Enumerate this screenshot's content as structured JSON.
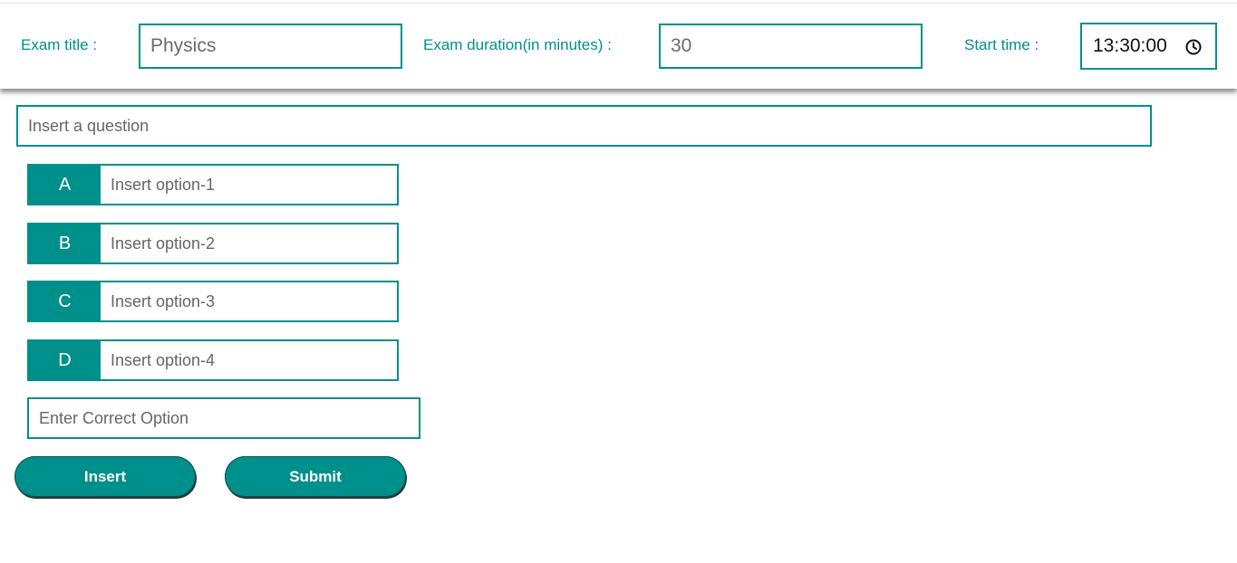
{
  "header": {
    "exam_title_label": "Exam title :",
    "exam_title_value": "Physics",
    "duration_label": "Exam duration(in minutes) :",
    "duration_value": "30",
    "start_time_label": "Start time :",
    "start_time_value": "13:30:00",
    "start_time_icon": "clock-icon"
  },
  "question": {
    "placeholder": "Insert a question"
  },
  "options": [
    {
      "letter": "A",
      "placeholder": "Insert option-1"
    },
    {
      "letter": "B",
      "placeholder": "Insert option-2"
    },
    {
      "letter": "C",
      "placeholder": "Insert option-3"
    },
    {
      "letter": "D",
      "placeholder": "Insert option-4"
    }
  ],
  "correct_option": {
    "placeholder": "Enter Correct Option"
  },
  "buttons": {
    "insert_label": "Insert",
    "submit_label": "Submit"
  },
  "colors": {
    "accent": "#00908c",
    "background": "#ffffff",
    "button_text": "#ffffff"
  }
}
